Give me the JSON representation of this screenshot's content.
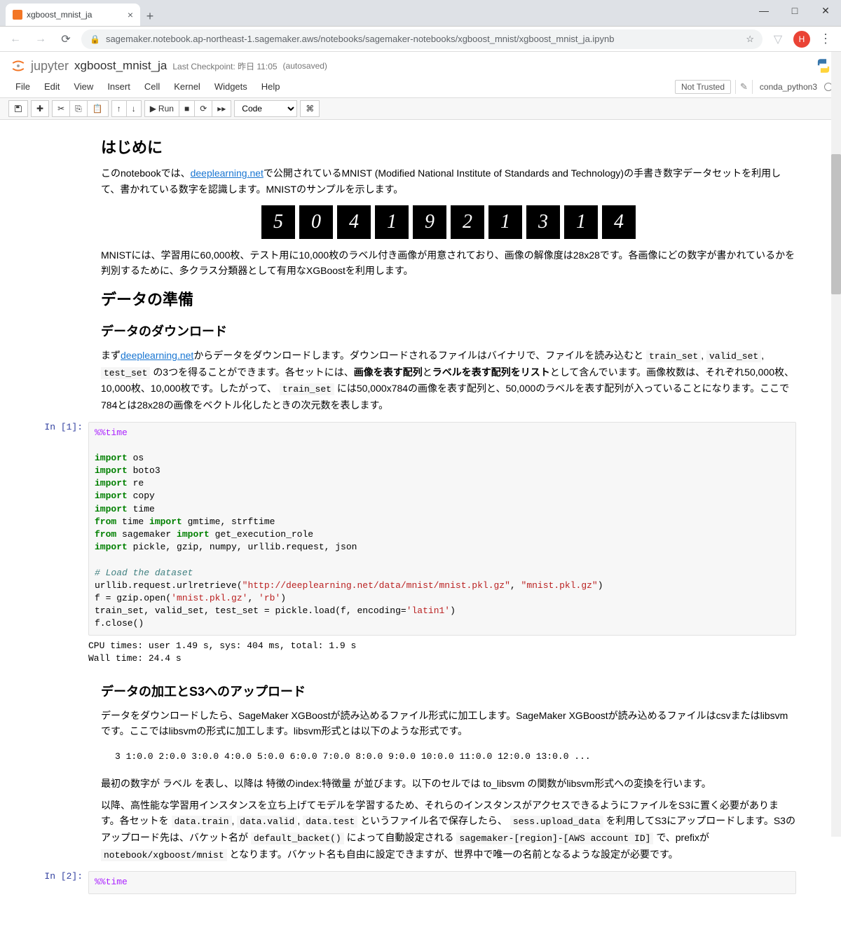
{
  "browser": {
    "tab_title": "xgboost_mnist_ja",
    "url": "sagemaker.notebook.ap-northeast-1.sagemaker.aws/notebooks/sagemaker-notebooks/xgboost_mnist/xgboost_mnist_ja.ipynb",
    "profile_letter": "H"
  },
  "header": {
    "logo_text": "jupyter",
    "nb_name": "xgboost_mnist_ja",
    "checkpoint_prefix": "Last Checkpoint: 昨日 11:05",
    "autosaved": "(autosaved)"
  },
  "menubar": {
    "items": [
      "File",
      "Edit",
      "View",
      "Insert",
      "Cell",
      "Kernel",
      "Widgets",
      "Help"
    ],
    "not_trusted": "Not Trusted",
    "kernel": "conda_python3"
  },
  "toolbar": {
    "run_label": "Run",
    "cell_type": "Code"
  },
  "content": {
    "h1": "はじめに",
    "p1a": "このnotebookでは、",
    "link1": "deeplearning.net",
    "p1b": "で公開されているMNIST (Modified National Institute of Standards and Technology)の手書き数字データセットを利用して、書かれている数字を認識します。MNISTのサンプルを示します。",
    "mnist_digits": [
      "5",
      "0",
      "4",
      "1",
      "9",
      "2",
      "1",
      "3",
      "1",
      "4"
    ],
    "p2": "MNISTには、学習用に60,000枚、テスト用に10,000枚のラベル付き画像が用意されており、画像の解像度は28x28です。各画像にどの数字が書かれているかを判別するために、多クラス分類器として有用なXGBoostを利用します。",
    "h2": "データの準備",
    "h3a": "データのダウンロード",
    "p3a": "まず",
    "link2": "deeplearning.net",
    "p3b": "からデータをダウンロードします。ダウンロードされるファイルはバイナリで、ファイルを読み込むと",
    "c_train": "train_set",
    "c_valid": "valid_set",
    "c_test": "test_set",
    "p3c": "の3つを得ることができます。各セットには、",
    "b1": "画像を表す配列",
    "p3d": "と",
    "b2": "ラベルを表す配列をリスト",
    "p3e": "として含んでいます。画像枚数は、それぞれ50,000枚、10,000枚、10,000枚です。したがって、",
    "p3f": " には50,000x784の画像を表す配列と、50,000のラベルを表す配列が入っていることになります。ここで784とは28x28の画像をベクトル化したときの次元数を表します。",
    "prompt1": "In [1]:",
    "out1_l1": "CPU times: user 1.49 s, sys: 404 ms, total: 1.9 s",
    "out1_l2": "Wall time: 24.4 s",
    "h3b": "データの加工とS3へのアップロード",
    "p4": "データをダウンロードしたら、SageMaker XGBoostが読み込めるファイル形式に加工します。SageMaker XGBoostが読み込めるファイルはcsvまたはlibsvmです。ここではlibsvmの形式に加工します。libsvm形式とは以下のような形式です。",
    "libsvm": "3 1:0.0 2:0.0 3:0.0 4:0.0 5:0.0 6:0.0 7:0.0 8:0.0 9:0.0 10:0.0 11:0.0 12:0.0 13:0.0 ...",
    "p5": "最初の数字が ラベル を表し、以降は 特徴のindex:特徴量 が並びます。以下のセルでは to_libsvm の関数がlibsvm形式への変換を行います。",
    "p6a": "以降、高性能な学習用インスタンスを立ち上げてモデルを学習するため、それらのインスタンスがアクセスできるようにファイルをS3に置く必要があります。各セットを",
    "c_d1": "data.train",
    "c_d2": "data.valid",
    "c_d3": "data.test",
    "p6b": " というファイル名で保存したら、 ",
    "c_up": "sess.upload_data",
    "p6c": " を利用してS3にアップロードします。S3のアップロード先は、バケット名が ",
    "c_bk": "default_backet()",
    "p6d": " によって自動設定される ",
    "c_reg": "sagemaker-[region]-[AWS account ID]",
    "p6e": " で、prefixが ",
    "c_pre": "notebook/xgboost/mnist",
    "p6f": " となります。バケット名も自由に設定できますが、世界中で唯一の名前となるような設定が必要です。",
    "prompt2": "In [2]:",
    "code2_l1": "%%time"
  }
}
